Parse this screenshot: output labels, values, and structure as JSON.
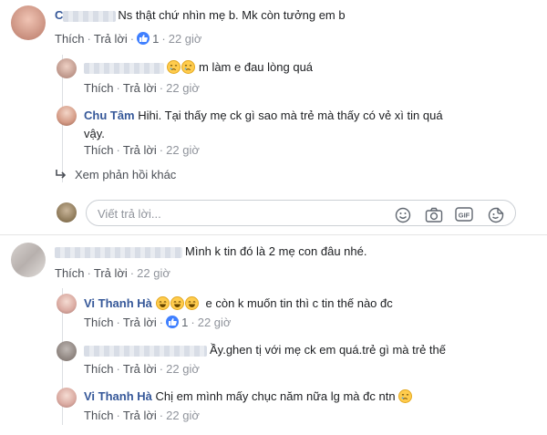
{
  "actions": {
    "like": "Thích",
    "reply": "Trả lời",
    "sep": "·"
  },
  "comments": [
    {
      "text": "Ns thật chứ nhìn mẹ b. Mk còn tưởng em b",
      "initial": "C",
      "like_count": "1",
      "time": "22 giờ",
      "replies": [
        {
          "text": "m làm e đau lòng quá",
          "time": "22 giờ"
        },
        {
          "name": "Chu Tâm",
          "text": "Hihi. Tại thấy mẹ ck gì sao mà trẻ mà thấy có vẻ xì tin quá",
          "text2": "vậy.",
          "time": "22 giờ"
        }
      ],
      "more_replies": "Xem phản hồi khác",
      "input_placeholder": "Viết trả lời..."
    },
    {
      "text": "Mình k tin đó là 2 mẹ con đâu nhé.",
      "time": "22 giờ",
      "replies": [
        {
          "name": "Vi Thanh Hà",
          "text": "e còn k muốn tin thì c tin thế nào đc",
          "like_count": "1",
          "time": "22 giờ"
        },
        {
          "text": "Ầy.ghen tị với mẹ ck em quá.trẻ gì mà trẻ thế",
          "time": "22 giờ"
        },
        {
          "name": "Vi Thanh Hà",
          "text": "Chị em mình mấy chục năm nữa lg mà đc ntn",
          "time": "22 giờ"
        }
      ]
    }
  ],
  "icons": {
    "more_arrow": "reply-arrow-icon",
    "smiley": "smiley-icon",
    "camera": "camera-icon",
    "gif": "gif-icon",
    "sticker": "sticker-icon"
  },
  "colors": {
    "name": "#365899",
    "like_badge": "#4080ff",
    "meta": "#90949c"
  }
}
